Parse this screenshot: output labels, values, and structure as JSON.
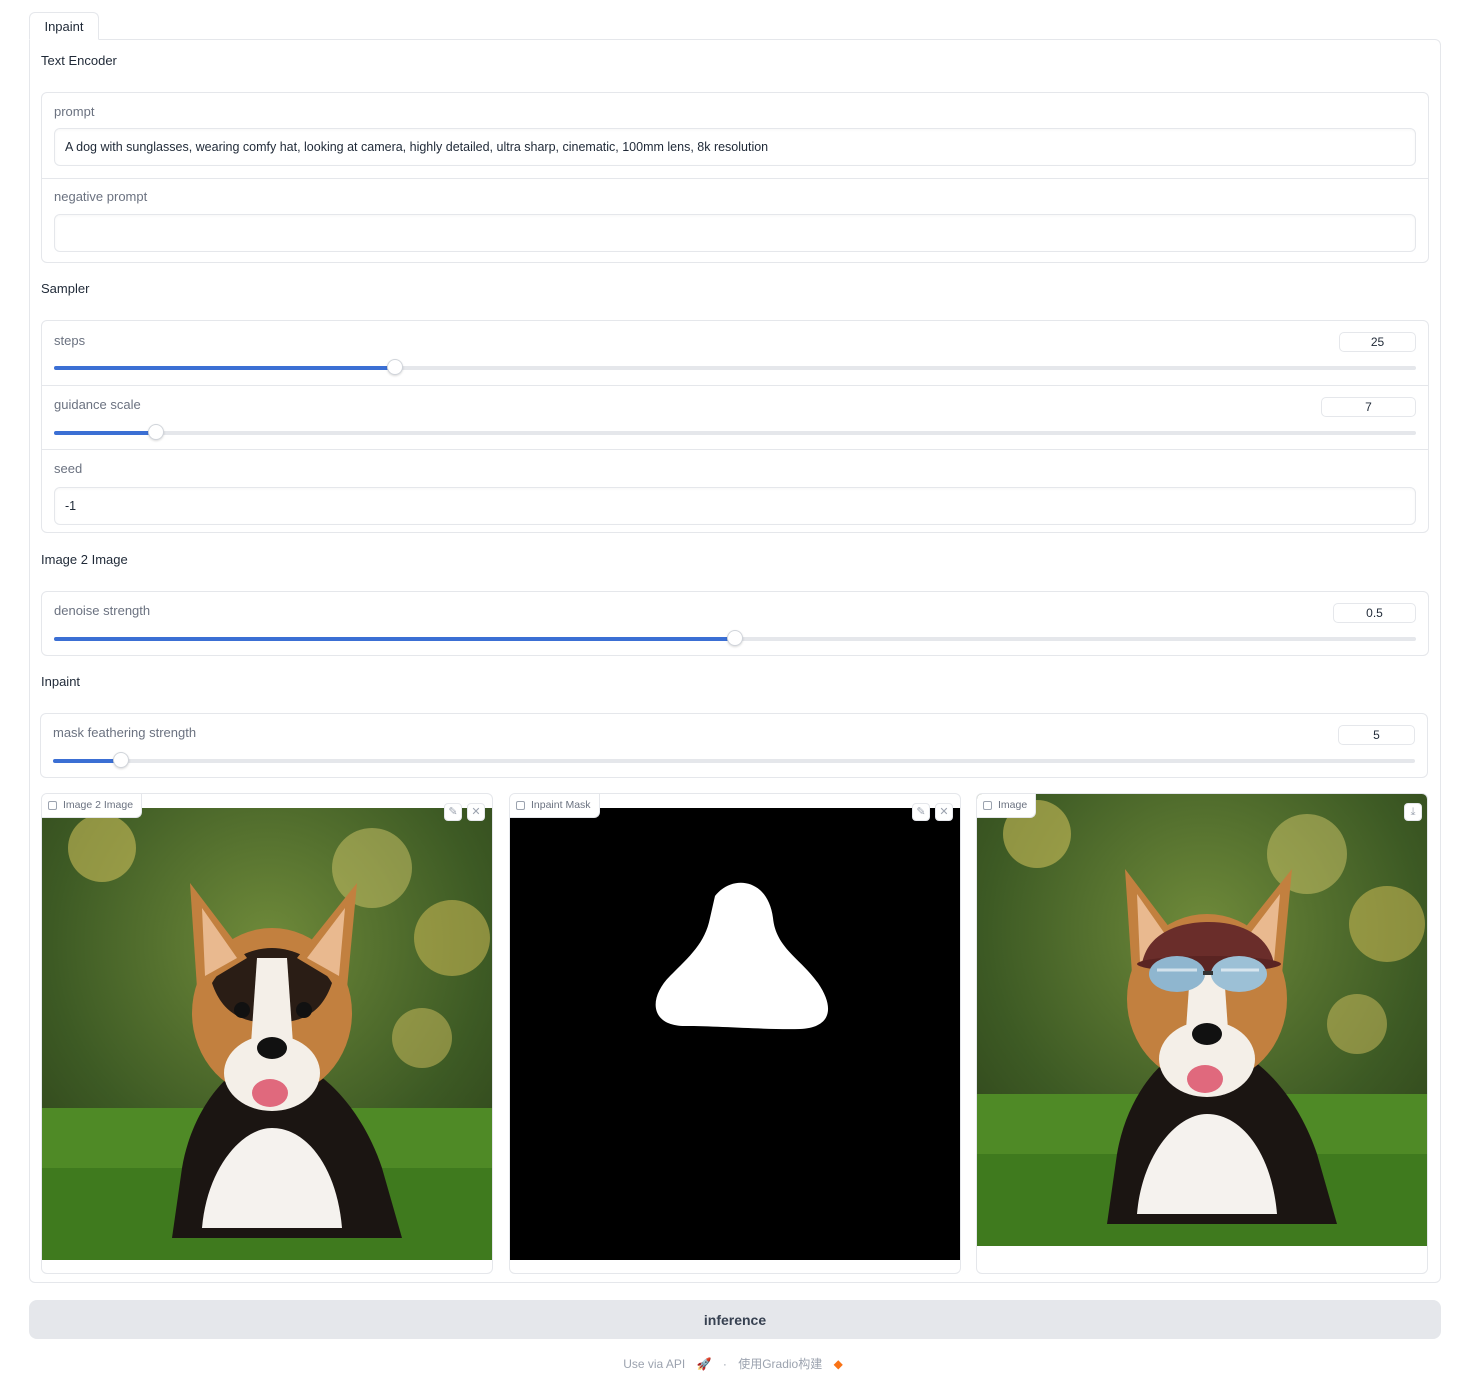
{
  "tabs": [
    {
      "label": "Inpaint"
    }
  ],
  "text_encoder": {
    "title": "Text Encoder",
    "prompt_label": "prompt",
    "prompt_value": "A dog with sunglasses, wearing comfy hat, looking at camera, highly detailed, ultra sharp, cinematic, 100mm lens, 8k resolution",
    "negative_label": "negative prompt",
    "negative_value": ""
  },
  "sampler": {
    "title": "Sampler",
    "steps": {
      "label": "steps",
      "value": "25",
      "fraction": 0.25
    },
    "guidance": {
      "label": "guidance scale",
      "value": "7",
      "fraction": 0.075
    },
    "seed": {
      "label": "seed",
      "value": "-1"
    }
  },
  "img2img": {
    "title": "Image 2 Image",
    "denoise": {
      "label": "denoise strength",
      "value": "0.5",
      "fraction": 0.5
    }
  },
  "inpaint": {
    "title": "Inpaint",
    "feather": {
      "label": "mask feathering strength",
      "value": "5",
      "fraction": 0.05
    }
  },
  "images": {
    "input_label": "Image 2 Image",
    "mask_label": "Inpaint Mask",
    "output_label": "Image"
  },
  "inference_button": "inference",
  "footer": {
    "api": "Use via API",
    "sep": "·",
    "built": "使用Gradio构建"
  },
  "colors": {
    "accent": "#3b6fd4",
    "track": "#e5e7eb",
    "button": "#e5e7eb"
  }
}
